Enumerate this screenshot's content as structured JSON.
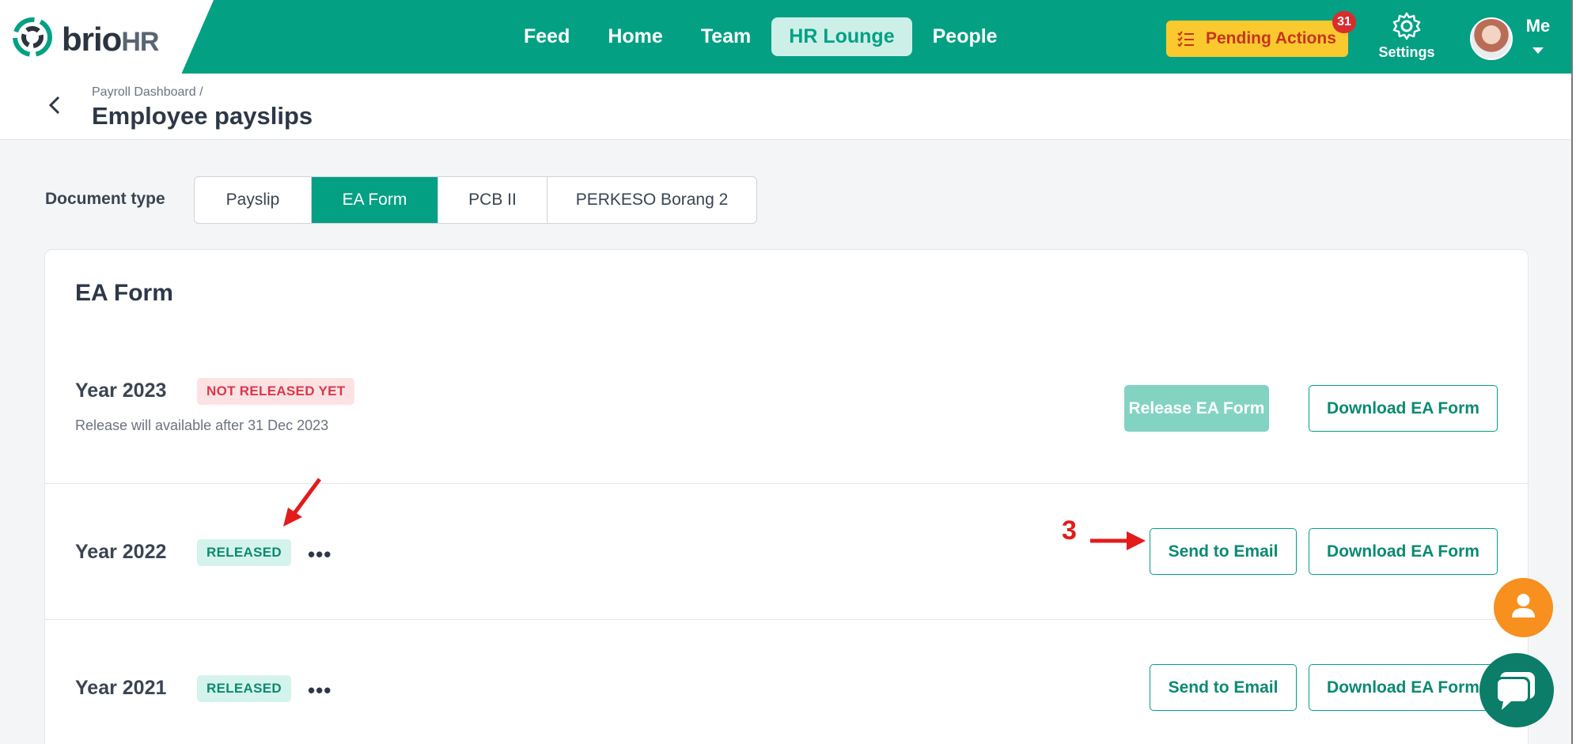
{
  "brand": {
    "name_main": "brio",
    "name_hr": "HR"
  },
  "nav": {
    "items": [
      {
        "label": "Feed"
      },
      {
        "label": "Home"
      },
      {
        "label": "Team"
      },
      {
        "label": "HR Lounge",
        "active": true
      },
      {
        "label": "People"
      }
    ]
  },
  "header": {
    "pending_label": "Pending Actions",
    "pending_count": "31",
    "settings_label": "Settings",
    "user_label": "Me"
  },
  "page": {
    "breadcrumb": "Payroll Dashboard  /",
    "title": "Employee payslips"
  },
  "doc_type": {
    "label": "Document type",
    "options": [
      {
        "label": "Payslip"
      },
      {
        "label": "EA Form",
        "active": true
      },
      {
        "label": "PCB II"
      },
      {
        "label": "PERKESO Borang 2"
      }
    ]
  },
  "card": {
    "title": "EA Form",
    "rows": [
      {
        "year": "Year 2023",
        "status": "NOT RELEASED YET",
        "note": "Release will available after 31 Dec 2023",
        "primary_button": "Release EA Form",
        "secondary_button": "Download EA Form"
      },
      {
        "year": "Year 2022",
        "status": "RELEASED",
        "more": "•••",
        "primary_button": "Send to Email",
        "secondary_button": "Download EA Form"
      },
      {
        "year": "Year 2021",
        "status": "RELEASED",
        "more": "•••",
        "primary_button": "Send to Email",
        "secondary_button": "Download EA Form"
      }
    ]
  },
  "annotation": {
    "step_number": "3"
  },
  "colors": {
    "brand_green": "#03a084",
    "pending_yellow": "#fac92e",
    "annotation_red": "#e31b1b",
    "fab_orange": "#f7901e"
  },
  "icons": [
    "brio-logo-icon",
    "checklist-icon",
    "gear-icon",
    "chevron-down-icon",
    "chevron-left-icon",
    "more-dots-icon",
    "person-icon",
    "chat-icon",
    "arrow-icon"
  ]
}
